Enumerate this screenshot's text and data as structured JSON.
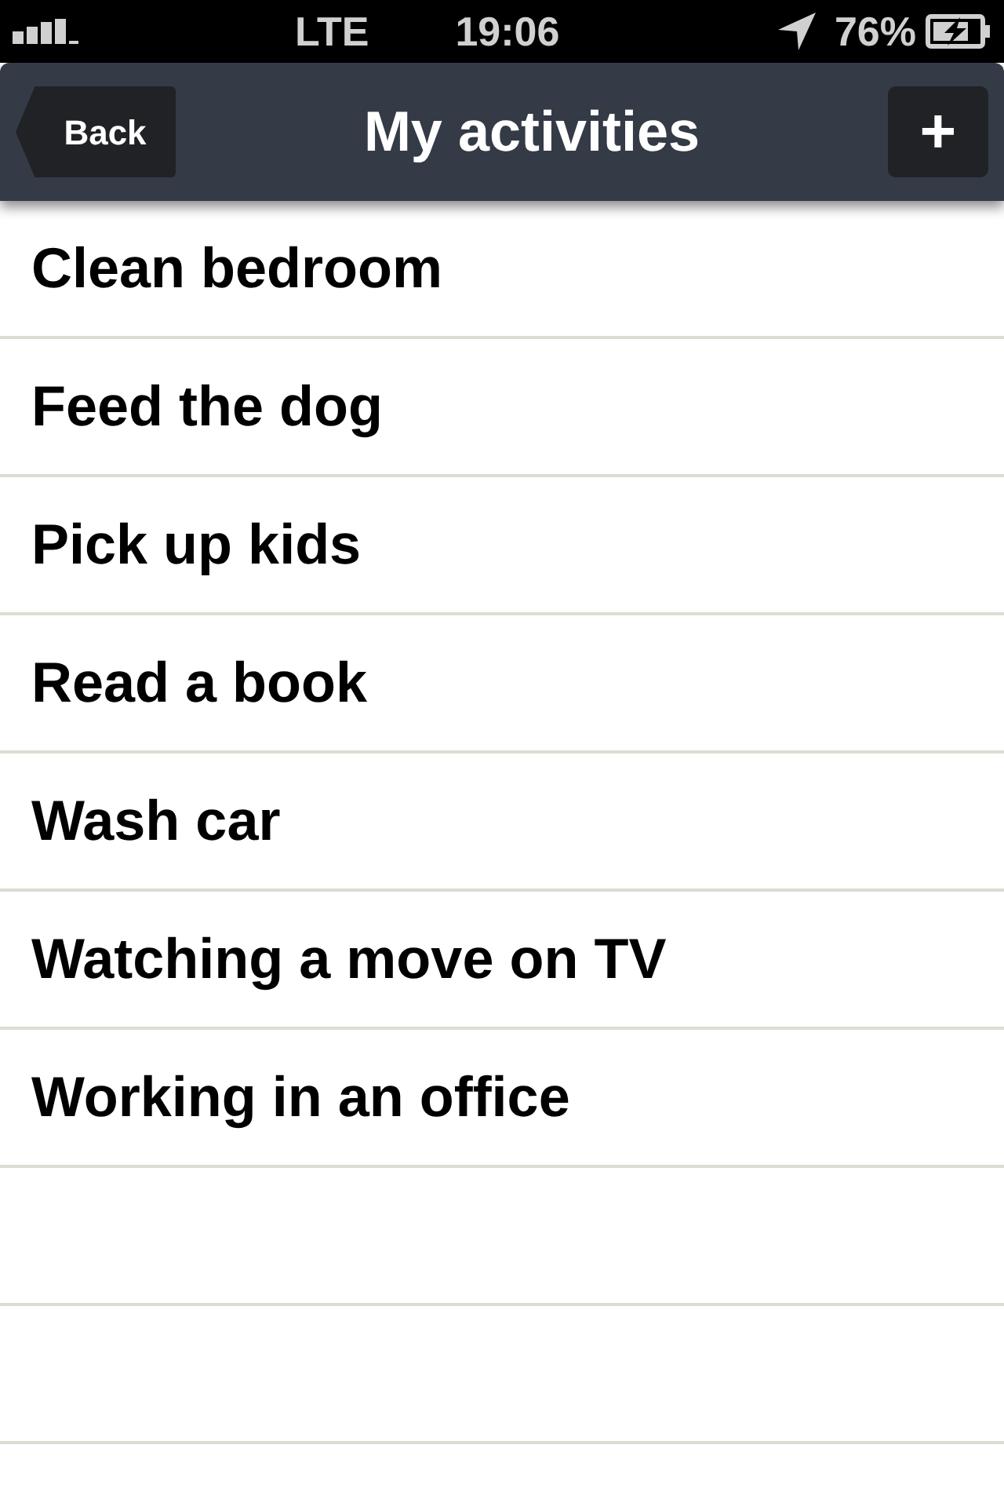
{
  "status_bar": {
    "network": "LTE",
    "time": "19:06",
    "battery": "76%"
  },
  "nav_bar": {
    "back": "Back",
    "title": "My activities",
    "add": "+"
  },
  "activities": [
    {
      "label": "Clean bedroom"
    },
    {
      "label": "Feed the dog"
    },
    {
      "label": "Pick up kids"
    },
    {
      "label": "Read a book"
    },
    {
      "label": "Wash car"
    },
    {
      "label": "Watching a move on TV"
    },
    {
      "label": "Working in an office"
    }
  ]
}
